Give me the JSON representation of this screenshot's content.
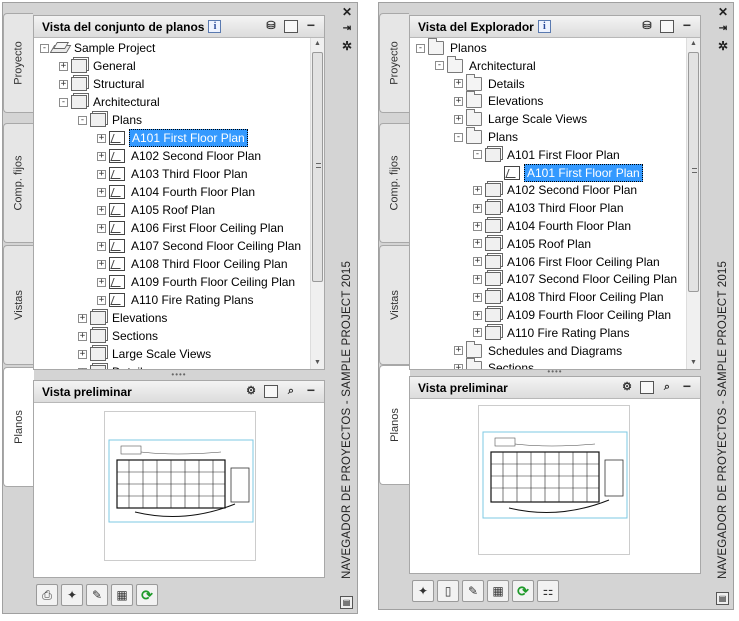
{
  "left": {
    "tabs": [
      "Proyecto",
      "Comp. fijos",
      "Vistas",
      "Planos"
    ],
    "active_tab": "Planos",
    "panel_title": "Vista del conjunto de planos",
    "preview_title": "Vista preliminar",
    "side_title": "NAVEGADOR DE PROYECTOS - SAMPLE PROJECT 2015",
    "tree": [
      {
        "label": "Sample Project",
        "icon": "project-icon",
        "expander": "-",
        "level": 0
      },
      {
        "label": "General",
        "icon": "sheet-set-icon",
        "expander": "+",
        "level": 1
      },
      {
        "label": "Structural",
        "icon": "sheet-set-icon",
        "expander": "+",
        "level": 1
      },
      {
        "label": "Architectural",
        "icon": "sheet-set-icon",
        "expander": "-",
        "level": 1
      },
      {
        "label": "Plans",
        "icon": "sheet-set-icon",
        "expander": "-",
        "level": 2
      },
      {
        "label": "A101 First Floor Plan",
        "icon": "sheet-icon",
        "expander": "+",
        "level": 3,
        "selected": true
      },
      {
        "label": "A102 Second Floor Plan",
        "icon": "sheet-icon",
        "expander": "+",
        "level": 3
      },
      {
        "label": "A103 Third Floor Plan",
        "icon": "sheet-icon",
        "expander": "+",
        "level": 3
      },
      {
        "label": "A104 Fourth Floor Plan",
        "icon": "sheet-icon",
        "expander": "+",
        "level": 3
      },
      {
        "label": "A105 Roof Plan",
        "icon": "sheet-icon",
        "expander": "+",
        "level": 3
      },
      {
        "label": "A106 First Floor Ceiling Plan",
        "icon": "sheet-icon",
        "expander": "+",
        "level": 3
      },
      {
        "label": "A107 Second Floor Ceiling Plan",
        "icon": "sheet-icon",
        "expander": "+",
        "level": 3
      },
      {
        "label": "A108 Third Floor Ceiling Plan",
        "icon": "sheet-icon",
        "expander": "+",
        "level": 3
      },
      {
        "label": "A109 Fourth Floor Ceiling Plan",
        "icon": "sheet-icon",
        "expander": "+",
        "level": 3
      },
      {
        "label": "A110 Fire Rating Plans",
        "icon": "sheet-icon",
        "expander": "+",
        "level": 3
      },
      {
        "label": "Elevations",
        "icon": "sheet-set-icon",
        "expander": "+",
        "level": 2
      },
      {
        "label": "Sections",
        "icon": "sheet-set-icon",
        "expander": "+",
        "level": 2
      },
      {
        "label": "Large Scale Views",
        "icon": "sheet-set-icon",
        "expander": "+",
        "level": 2
      },
      {
        "label": "Details",
        "icon": "sheet-set-icon",
        "expander": "+",
        "level": 2
      }
    ]
  },
  "right": {
    "tabs": [
      "Proyecto",
      "Comp. fijos",
      "Vistas",
      "Planos"
    ],
    "active_tab": "Planos",
    "panel_title": "Vista del Explorador",
    "preview_title": "Vista preliminar",
    "side_title": "NAVEGADOR DE PROYECTOS - SAMPLE PROJECT 2015",
    "tree": [
      {
        "label": "Planos",
        "icon": "folder-icon",
        "expander": "-",
        "level": 0
      },
      {
        "label": "Architectural",
        "icon": "folder-icon",
        "expander": "-",
        "level": 1
      },
      {
        "label": "Details",
        "icon": "folder-icon",
        "expander": "+",
        "level": 2
      },
      {
        "label": "Elevations",
        "icon": "folder-icon",
        "expander": "+",
        "level": 2
      },
      {
        "label": "Large Scale Views",
        "icon": "folder-icon",
        "expander": "+",
        "level": 2
      },
      {
        "label": "Plans",
        "icon": "folder-icon",
        "expander": "-",
        "level": 2
      },
      {
        "label": "A101 First Floor Plan",
        "icon": "drawing-icon",
        "expander": "-",
        "level": 3
      },
      {
        "label": "A101 First Floor Plan",
        "icon": "sheet-icon",
        "expander": "",
        "level": 4,
        "selected": true
      },
      {
        "label": "A102 Second Floor Plan",
        "icon": "drawing-icon",
        "expander": "+",
        "level": 3
      },
      {
        "label": "A103 Third Floor Plan",
        "icon": "drawing-icon",
        "expander": "+",
        "level": 3
      },
      {
        "label": "A104 Fourth Floor Plan",
        "icon": "drawing-icon",
        "expander": "+",
        "level": 3
      },
      {
        "label": "A105 Roof Plan",
        "icon": "drawing-icon",
        "expander": "+",
        "level": 3
      },
      {
        "label": "A106 First Floor Ceiling Plan",
        "icon": "drawing-icon",
        "expander": "+",
        "level": 3
      },
      {
        "label": "A107 Second Floor Ceiling Plan",
        "icon": "drawing-icon",
        "expander": "+",
        "level": 3
      },
      {
        "label": "A108 Third Floor Ceiling Plan",
        "icon": "drawing-icon",
        "expander": "+",
        "level": 3
      },
      {
        "label": "A109 Fourth Floor Ceiling Plan",
        "icon": "drawing-icon",
        "expander": "+",
        "level": 3
      },
      {
        "label": "A110 Fire Rating Plans",
        "icon": "drawing-icon",
        "expander": "+",
        "level": 3
      },
      {
        "label": "Schedules and Diagrams",
        "icon": "folder-icon",
        "expander": "+",
        "level": 2
      },
      {
        "label": "Sections",
        "icon": "folder-icon",
        "expander": "+",
        "level": 2
      }
    ]
  },
  "colors": {
    "selection": "#3399ff",
    "palette_bg": "#d4d4d4",
    "refresh_green": "#1f9a2a"
  }
}
